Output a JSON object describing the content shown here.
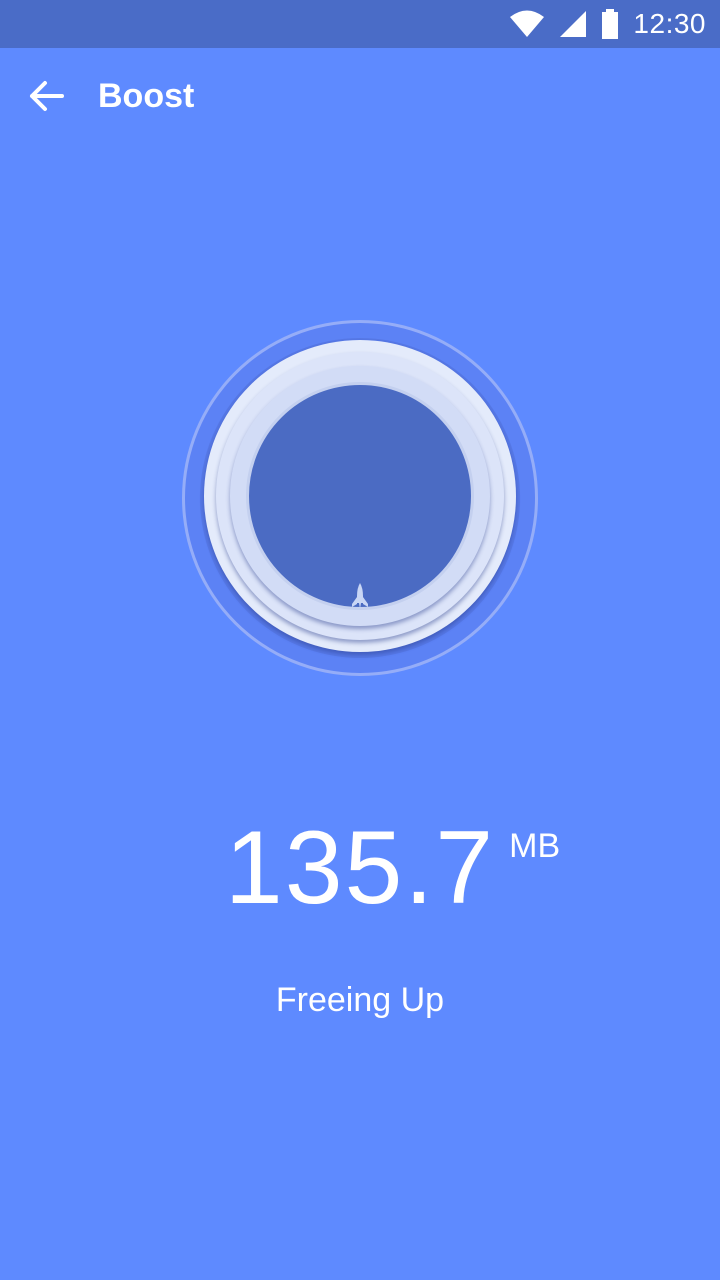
{
  "status_bar": {
    "time": "12:30",
    "icons": [
      "wifi-icon",
      "cell-signal-icon",
      "battery-icon"
    ]
  },
  "app_bar": {
    "title": "Boost",
    "back_icon": "arrow-back-icon"
  },
  "boost": {
    "icon": "rocket-icon",
    "amount": "135.7",
    "unit": "MB",
    "status": "Freeing Up"
  },
  "colors": {
    "background": "#5E8AFF",
    "status_bar": "#4A6CC7",
    "circle_core": "#4B6BC3",
    "text": "#FFFFFF"
  }
}
